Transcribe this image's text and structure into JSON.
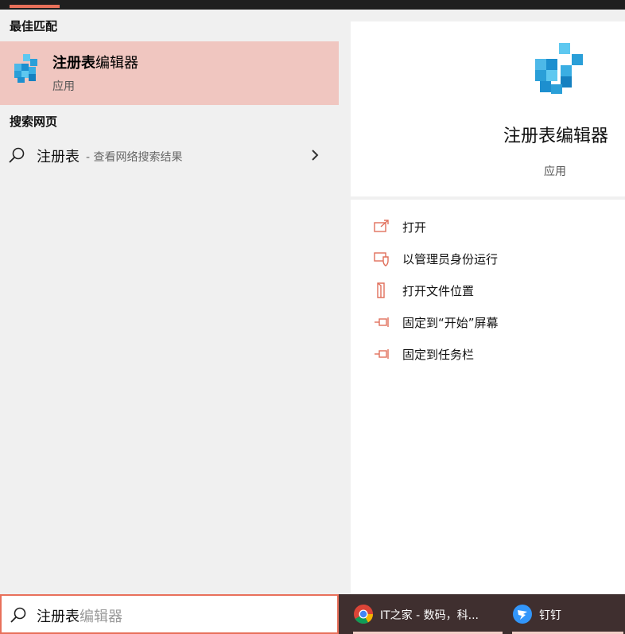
{
  "topbar": {
    "accent_color": "#e8705a"
  },
  "left": {
    "best_match_title": "最佳匹配",
    "best_match": {
      "name_bold": "注册表",
      "name_rest": "编辑器",
      "kind": "应用",
      "icon": "registry-editor-icon"
    },
    "web_title": "搜索网页",
    "web_result": {
      "query": "注册表",
      "hint": "- 查看网络搜索结果",
      "icon": "search-icon"
    }
  },
  "preview": {
    "title": "注册表编辑器",
    "kind": "应用",
    "actions": [
      {
        "label": "打开",
        "icon": "open-icon"
      },
      {
        "label": "以管理员身份运行",
        "icon": "run-as-admin-icon"
      },
      {
        "label": "打开文件位置",
        "icon": "file-location-icon"
      },
      {
        "label": "固定到“开始”屏幕",
        "icon": "pin-start-icon"
      },
      {
        "label": "固定到任务栏",
        "icon": "pin-taskbar-icon"
      }
    ]
  },
  "searchbox": {
    "typed": "注册表",
    "suggestion": "编辑器"
  },
  "taskbar": {
    "items": [
      {
        "label": "IT之家 - 数码，科...",
        "icon": "chrome-icon"
      },
      {
        "label": "钉钉",
        "icon": "dingtalk-icon"
      }
    ]
  }
}
